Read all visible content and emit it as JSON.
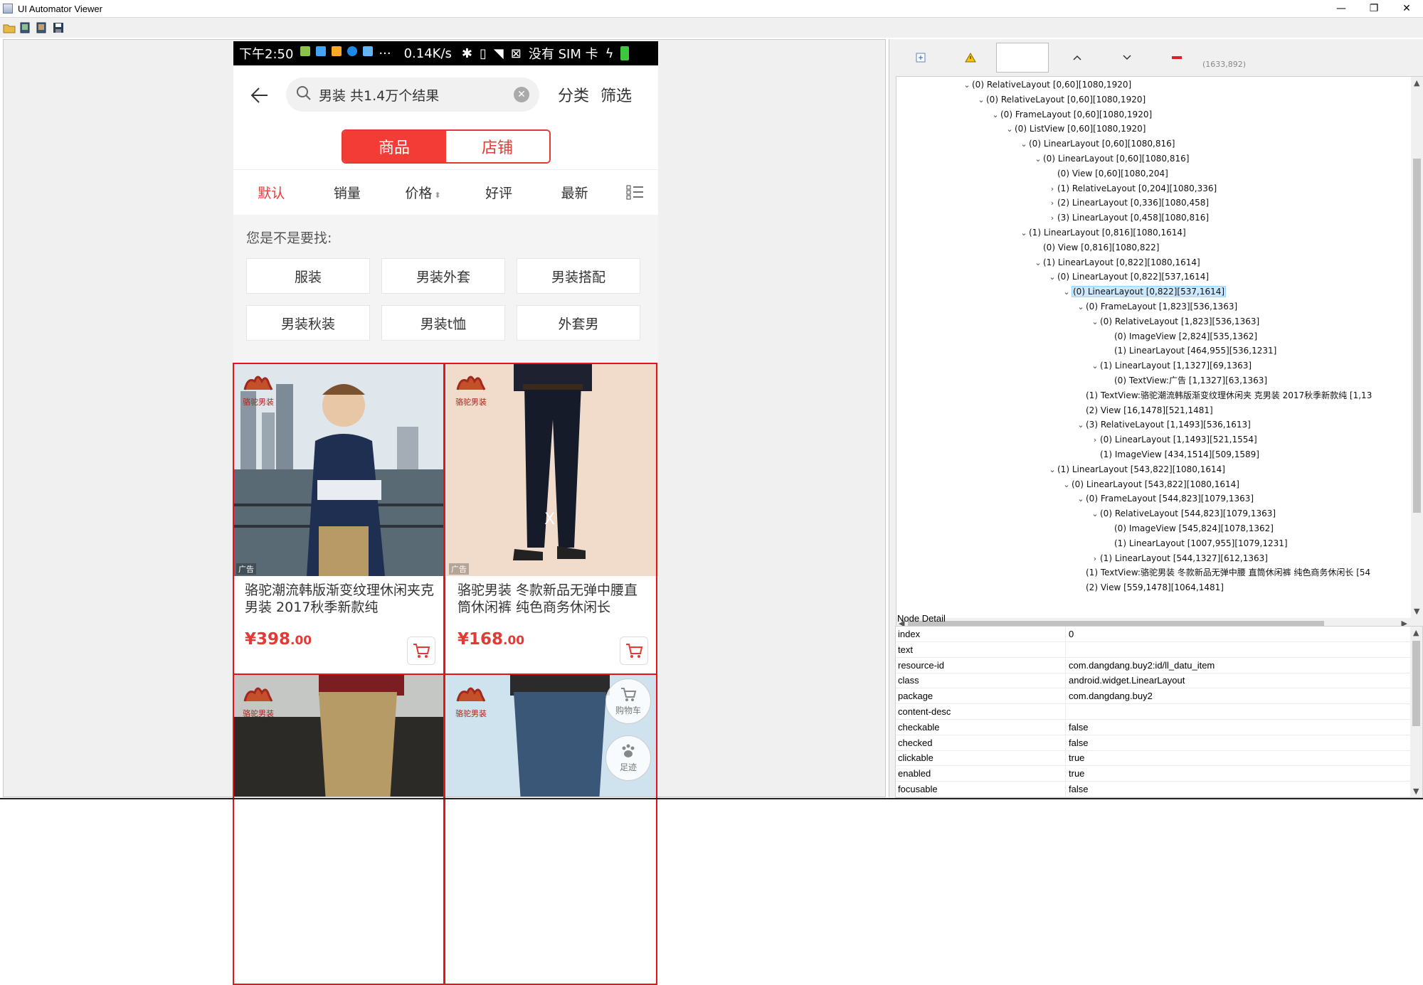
{
  "window": {
    "title": "UI Automator Viewer",
    "minimize": "—",
    "restore": "❐",
    "close": "✕"
  },
  "phone": {
    "status": {
      "time": "下午2:50",
      "dots": "···",
      "rate": "0.14K/s",
      "no_sim": "没有 SIM 卡"
    },
    "search": {
      "query": "男装 共1.4万个结果",
      "category": "分类",
      "filter": "筛选"
    },
    "segments": {
      "goods": "商品",
      "shops": "店铺"
    },
    "sort": {
      "default": "默认",
      "sales": "销量",
      "price": "价格",
      "rating": "好评",
      "newest": "最新"
    },
    "suggest_title": "您是不是要找:",
    "chips": [
      "服装",
      "男装外套",
      "男装搭配",
      "男装秋装",
      "男装t恤",
      "外套男"
    ],
    "products": [
      {
        "title": "骆驼潮流韩版渐变纹理休闲夹克男装 2017秋季新款纯",
        "price_int": "¥398",
        "price_cents": ".00",
        "ad": "广告",
        "brand": "骆驼男装"
      },
      {
        "title": "骆驼男装 冬款新品无弹中腰直筒休闲裤 纯色商务休闲长",
        "price_int": "¥168",
        "price_cents": ".00",
        "ad": "广告",
        "brand": "骆驼男装"
      }
    ],
    "row2": [
      {
        "brand": "骆驼男装"
      },
      {
        "brand": "骆驼男装",
        "cart_label": "购物车",
        "footprint_label": "足迹"
      }
    ],
    "x_marker": "X"
  },
  "inspector": {
    "coordinates": "(1633,892)",
    "tree": [
      {
        "indent": 0,
        "expanded": "open",
        "text": "(0) RelativeLayout [0,60][1080,1920]"
      },
      {
        "indent": 1,
        "expanded": "open",
        "text": "(0) RelativeLayout [0,60][1080,1920]"
      },
      {
        "indent": 2,
        "expanded": "open",
        "text": "(0) FrameLayout [0,60][1080,1920]"
      },
      {
        "indent": 3,
        "expanded": "open",
        "text": "(0) ListView [0,60][1080,1920]"
      },
      {
        "indent": 4,
        "expanded": "open",
        "text": "(0) LinearLayout [0,60][1080,816]"
      },
      {
        "indent": 5,
        "expanded": "open",
        "text": "(0) LinearLayout [0,60][1080,816]"
      },
      {
        "indent": 6,
        "expanded": "none",
        "text": "(0) View [0,60][1080,204]"
      },
      {
        "indent": 6,
        "expanded": "closed",
        "text": "(1) RelativeLayout [0,204][1080,336]"
      },
      {
        "indent": 6,
        "expanded": "closed",
        "text": "(2) LinearLayout [0,336][1080,458]"
      },
      {
        "indent": 6,
        "expanded": "closed",
        "text": "(3) LinearLayout [0,458][1080,816]"
      },
      {
        "indent": 4,
        "expanded": "open",
        "text": "(1) LinearLayout [0,816][1080,1614]"
      },
      {
        "indent": 5,
        "expanded": "none",
        "text": "(0) View [0,816][1080,822]"
      },
      {
        "indent": 5,
        "expanded": "open",
        "text": "(1) LinearLayout [0,822][1080,1614]"
      },
      {
        "indent": 6,
        "expanded": "open",
        "text": "(0) LinearLayout [0,822][537,1614]"
      },
      {
        "indent": 7,
        "expanded": "open",
        "text": "(0) LinearLayout [0,822][537,1614]",
        "selected": true
      },
      {
        "indent": 8,
        "expanded": "open",
        "text": "(0) FrameLayout [1,823][536,1363]"
      },
      {
        "indent": 9,
        "expanded": "open",
        "text": "(0) RelativeLayout [1,823][536,1363]"
      },
      {
        "indent": 10,
        "expanded": "none",
        "text": "(0) ImageView [2,824][535,1362]"
      },
      {
        "indent": 10,
        "expanded": "none",
        "text": "(1) LinearLayout [464,955][536,1231]"
      },
      {
        "indent": 9,
        "expanded": "open",
        "text": "(1) LinearLayout [1,1327][69,1363]"
      },
      {
        "indent": 10,
        "expanded": "none",
        "text": "(0) TextView:广告 [1,1327][63,1363]"
      },
      {
        "indent": 8,
        "expanded": "none",
        "text": "(1) TextView:骆驼潮流韩版渐变纹理休闲夹 克男装 2017秋季新款纯 [1,13"
      },
      {
        "indent": 8,
        "expanded": "none",
        "text": "(2) View [16,1478][521,1481]"
      },
      {
        "indent": 8,
        "expanded": "open",
        "text": "(3) RelativeLayout [1,1493][536,1613]"
      },
      {
        "indent": 9,
        "expanded": "closed",
        "text": "(0) LinearLayout [1,1493][521,1554]"
      },
      {
        "indent": 9,
        "expanded": "none",
        "text": "(1) ImageView [434,1514][509,1589]"
      },
      {
        "indent": 6,
        "expanded": "open",
        "text": "(1) LinearLayout [543,822][1080,1614]"
      },
      {
        "indent": 7,
        "expanded": "open",
        "text": "(0) LinearLayout [543,822][1080,1614]"
      },
      {
        "indent": 8,
        "expanded": "open",
        "text": "(0) FrameLayout [544,823][1079,1363]"
      },
      {
        "indent": 9,
        "expanded": "open",
        "text": "(0) RelativeLayout [544,823][1079,1363]"
      },
      {
        "indent": 10,
        "expanded": "none",
        "text": "(0) ImageView [545,824][1078,1362]"
      },
      {
        "indent": 10,
        "expanded": "none",
        "text": "(1) LinearLayout [1007,955][1079,1231]"
      },
      {
        "indent": 9,
        "expanded": "closed",
        "text": "(1) LinearLayout [544,1327][612,1363]"
      },
      {
        "indent": 8,
        "expanded": "none",
        "text": "(1) TextView:骆驼男装 冬款新品无弹中腰 直筒休闲裤 纯色商务休闲长 [54"
      },
      {
        "indent": 8,
        "expanded": "none",
        "text": "(2) View [559,1478][1064,1481]"
      }
    ],
    "detail_title": "Node Detail",
    "details": [
      {
        "key": "index",
        "value": "0"
      },
      {
        "key": "text",
        "value": ""
      },
      {
        "key": "resource-id",
        "value": "com.dangdang.buy2:id/ll_datu_item"
      },
      {
        "key": "class",
        "value": "android.widget.LinearLayout"
      },
      {
        "key": "package",
        "value": "com.dangdang.buy2"
      },
      {
        "key": "content-desc",
        "value": ""
      },
      {
        "key": "checkable",
        "value": "false"
      },
      {
        "key": "checked",
        "value": "false"
      },
      {
        "key": "clickable",
        "value": "true"
      },
      {
        "key": "enabled",
        "value": "true"
      },
      {
        "key": "focusable",
        "value": "false"
      }
    ]
  }
}
